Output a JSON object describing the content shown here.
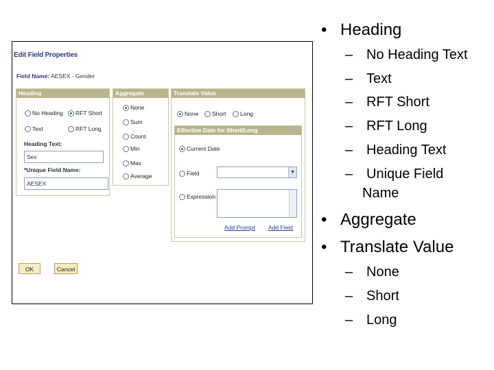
{
  "dialog": {
    "title": "Edit Field Properties",
    "field_name_label": "Field Name:",
    "field_name_value": "AESEX - Gender",
    "heading_panel": {
      "title": "Heading",
      "options": [
        "No Heading",
        "RFT Short",
        "Text",
        "RFT Long"
      ],
      "selected": "RFT Short",
      "heading_text_label": "Heading Text:",
      "heading_text_value": "Sex",
      "unique_label": "*Unique Field Name:",
      "unique_value": "AESEX"
    },
    "aggregate_panel": {
      "title": "Aggregate",
      "options": [
        "None",
        "Sum",
        "Count",
        "Min",
        "Max",
        "Average"
      ],
      "selected": "None"
    },
    "translate_panel": {
      "title": "Translate Value",
      "options": [
        "None",
        "Short",
        "Long"
      ],
      "selected": "None"
    },
    "effective_panel": {
      "title": "Effective Date for Short/Long",
      "current_date": "Current Date",
      "field": "Field",
      "expression": "Expression",
      "add_prompt": "Add Prompt",
      "add_field": "Add Field"
    },
    "ok_label": "OK",
    "cancel_label": "Cancel"
  },
  "bullets": {
    "heading": "Heading",
    "heading_items": [
      "No Heading Text",
      "Text",
      "RFT Short",
      "RFT Long",
      "Heading Text",
      "Unique Field"
    ],
    "heading_item_cont": "Name",
    "aggregate": "Aggregate",
    "translate": "Translate Value",
    "translate_items": [
      "None",
      "Short",
      "Long"
    ],
    "bullet_glyph": "•",
    "dash_glyph": "–"
  }
}
